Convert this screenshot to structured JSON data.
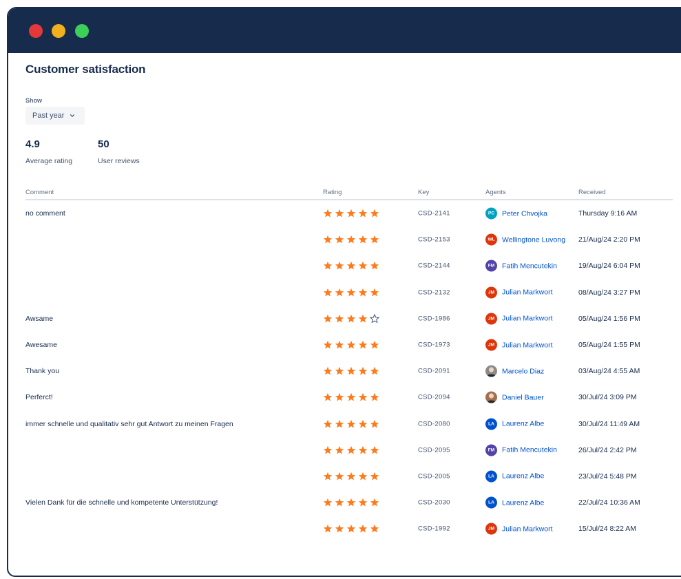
{
  "window": {
    "traffic_lights": [
      "#e5383b",
      "#f2b01e",
      "#3ccf5a"
    ],
    "titlebar_color": "#172b4d"
  },
  "page": {
    "title": "Customer satisfaction"
  },
  "filter": {
    "label": "Show",
    "selected": "Past year",
    "icon": "chevron-down-icon"
  },
  "stats": {
    "average": {
      "value": "4.9",
      "label": "Average rating"
    },
    "reviews": {
      "value": "50",
      "label": "User reviews"
    }
  },
  "table": {
    "headers": {
      "comment": "Comment",
      "rating": "Rating",
      "key": "Key",
      "agents": "Agents",
      "received": "Received"
    },
    "star_color": "#ff7a1a",
    "rows": [
      {
        "comment": "no comment",
        "rating": 5,
        "key": "CSD-2141",
        "agent": "Peter Chvojka",
        "initials": "PC",
        "avatar_color": "#00a3bf",
        "received": "Thursday 9:16 AM"
      },
      {
        "comment": "",
        "rating": 5,
        "key": "CSD-2153",
        "agent": "Wellingtone Luvong",
        "initials": "WL",
        "avatar_color": "#de350b",
        "received": "21/Aug/24 2:20 PM"
      },
      {
        "comment": "",
        "rating": 5,
        "key": "CSD-2144",
        "agent": "Fatih Mencutekin",
        "initials": "FM",
        "avatar_color": "#5243aa",
        "received": "19/Aug/24 6:04 PM"
      },
      {
        "comment": "",
        "rating": 5,
        "key": "CSD-2132",
        "agent": "Julian Markwort",
        "initials": "JM",
        "avatar_color": "#de350b",
        "received": "08/Aug/24 3:27 PM"
      },
      {
        "comment": "Awsame",
        "rating": 4,
        "key": "CSD-1986",
        "agent": "Julian Markwort",
        "initials": "JM",
        "avatar_color": "#de350b",
        "received": "05/Aug/24 1:56 PM"
      },
      {
        "comment": "Awesame",
        "rating": 5,
        "key": "CSD-1973",
        "agent": "Julian Markwort",
        "initials": "JM",
        "avatar_color": "#de350b",
        "received": "05/Aug/24 1:55 PM"
      },
      {
        "comment": "Thank you",
        "rating": 5,
        "key": "CSD-2091",
        "agent": "Marcelo Diaz",
        "initials": "",
        "avatar_color": "#8a8a8a",
        "avatar_photo": true,
        "received": "03/Aug/24 4:55 AM"
      },
      {
        "comment": "Perferct!",
        "rating": 5,
        "key": "CSD-2094",
        "agent": "Daniel Bauer",
        "initials": "",
        "avatar_color": "#a0704f",
        "avatar_photo": true,
        "received": "30/Jul/24 3:09 PM"
      },
      {
        "comment": "immer schnelle und qualitativ sehr gut Antwort zu meinen Fragen",
        "rating": 5,
        "key": "CSD-2080",
        "agent": "Laurenz Albe",
        "initials": "LA",
        "avatar_color": "#0052cc",
        "received": "30/Jul/24 11:49 AM"
      },
      {
        "comment": "",
        "rating": 5,
        "key": "CSD-2095",
        "agent": "Fatih Mencutekin",
        "initials": "FM",
        "avatar_color": "#5243aa",
        "received": "26/Jul/24 2:42 PM"
      },
      {
        "comment": "",
        "rating": 5,
        "key": "CSD-2005",
        "agent": "Laurenz Albe",
        "initials": "LA",
        "avatar_color": "#0052cc",
        "received": "23/Jul/24 5:48 PM"
      },
      {
        "comment": "Vielen Dank für die schnelle und kompetente Unterstützung!",
        "rating": 5,
        "key": "CSD-2030",
        "agent": "Laurenz Albe",
        "initials": "LA",
        "avatar_color": "#0052cc",
        "received": "22/Jul/24 10:36 AM"
      },
      {
        "comment": "",
        "rating": 5,
        "key": "CSD-1992",
        "agent": "Julian Markwort",
        "initials": "JM",
        "avatar_color": "#de350b",
        "received": "15/Jul/24 8:22 AM"
      }
    ]
  }
}
